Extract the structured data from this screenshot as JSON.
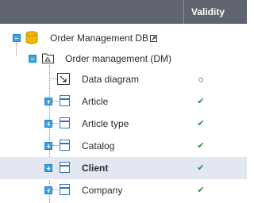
{
  "header": {
    "validity_label": "Validity"
  },
  "tree": {
    "root": {
      "label": "Order Management DB",
      "icon": "database-icon",
      "expanded": true
    },
    "model": {
      "label": "Order management (DM)",
      "icon": "model-folder-icon",
      "expanded": true
    },
    "items": [
      {
        "label": "Data diagram",
        "icon": "diagram-icon",
        "validity": "○",
        "expandable": false,
        "selected": false
      },
      {
        "label": "Article",
        "icon": "entity-icon",
        "validity": "✔",
        "expandable": true,
        "selected": false
      },
      {
        "label": "Article type",
        "icon": "entity-icon",
        "validity": "✔",
        "expandable": true,
        "selected": false
      },
      {
        "label": "Catalog",
        "icon": "entity-icon",
        "validity": "✔",
        "expandable": true,
        "selected": false
      },
      {
        "label": "Client",
        "icon": "entity-icon",
        "validity": "✔",
        "expandable": true,
        "selected": true
      },
      {
        "label": "Company",
        "icon": "entity-icon",
        "validity": "✔",
        "expandable": true,
        "selected": false
      }
    ]
  },
  "colors": {
    "header_bg": "#5f6470",
    "selected_row_bg": "#e3e7f1",
    "expander": "#3fa1e0",
    "entity_icon": "#2f73c9",
    "valid_check": "#2f8a3a",
    "database_icon": "#f2b705"
  }
}
